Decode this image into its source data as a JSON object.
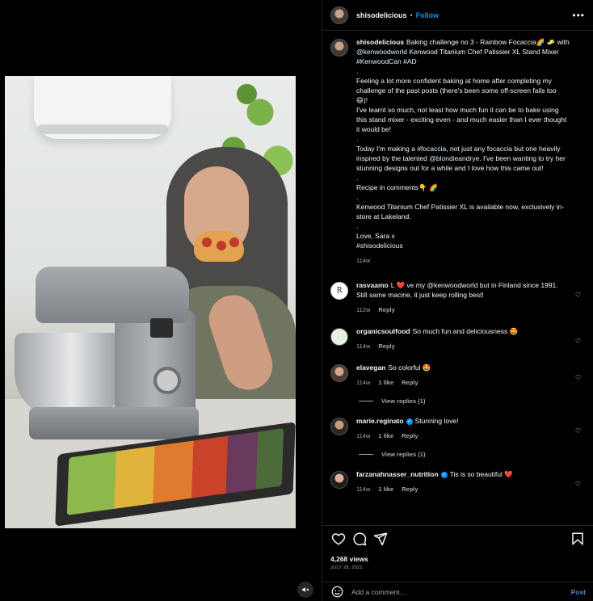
{
  "post": {
    "username": "shisodelicious",
    "follow_label": "Follow",
    "separator": "•",
    "more_label": "•••"
  },
  "caption": {
    "username": "shisodelicious",
    "line1": "Baking challenge no 3 - Rainbow Focaccia🌈 🧈 with ",
    "mention_kenwood": "@kenwoodworld",
    "line1b": " Kenwood Titanium Chef Patissier XL Stand Mixer ",
    "tag_kenwoodcan": "#KenwoodCan",
    "tag_ad": "#AD",
    "dot": ".",
    "p1": "Feeling a lot more confident baking at home after completing my challenge of the past posts (there's been some off-screen fails too 😄)!",
    "p2": "I've learnt so much, not least how much fun it can be to bake using this stand mixer - exciting even - and much easier than I ever thought it would be!",
    "p3a": "Today I'm making a ",
    "tag_focaccia": "#focaccia",
    "p3b": ", not just any focaccia but one heavily inspired by the talented ",
    "mention_blondie": "@blondieandrye",
    "p3c": ". I've been wanting to try her stunning designs out for a while and I love how this came out!",
    "p4": "Recipe in comments👇 🌈",
    "p5": "Kenwood Titanium Chef Patissier XL is available now, exclusively in-store at Lakeland.",
    "p6": "Love, Sara x",
    "tag_shisodelicious": "#shisodelicious",
    "time": "114w"
  },
  "comments": [
    {
      "username": "rasvaamo",
      "text": "L ❤️ ve my @kenwoodworld but in Finland since 1991.\nStill same macine, it just keep rolling best!",
      "time": "112w",
      "likes": "",
      "reply": "Reply"
    },
    {
      "username": "organicsoulfood",
      "text": "So much fun and deliciousness 🤩",
      "time": "114w",
      "likes": "",
      "reply": "Reply"
    },
    {
      "username": "elavegan",
      "text": "So colorful 🤩",
      "time": "114w",
      "likes": "1 like",
      "reply": "Reply",
      "view_replies": "View replies (1)"
    },
    {
      "username": "marie.reginato",
      "text": "Stunning love!",
      "time": "114w",
      "likes": "1 like",
      "reply": "Reply",
      "view_replies": "View replies (1)",
      "verified": true
    },
    {
      "username": "farzanahnasser_nutrition",
      "text": "Tis is so beautiful ❤️",
      "time": "114w",
      "likes": "1 like",
      "reply": "Reply",
      "verified": true
    }
  ],
  "footer": {
    "views": "4,268 views",
    "date": "JULY 28, 2021",
    "add_comment_placeholder": "Add a comment…",
    "post_label": "Post"
  },
  "media": {
    "mute_icon": "speaker-muted-icon"
  }
}
